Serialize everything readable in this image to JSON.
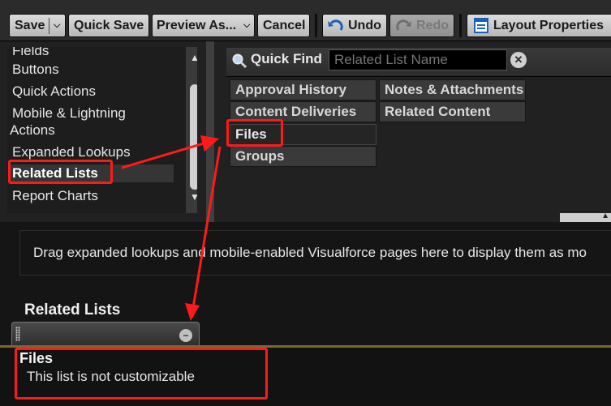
{
  "toolbar": {
    "save_label": "Save",
    "quick_save_label": "Quick Save",
    "preview_as_label": "Preview As...",
    "cancel_label": "Cancel",
    "undo_label": "Undo",
    "redo_label": "Redo",
    "layout_properties_label": "Layout Properties"
  },
  "palette": {
    "categories": [
      {
        "label": "Fields"
      },
      {
        "label": "Buttons"
      },
      {
        "label": "Quick Actions"
      },
      {
        "label": "Mobile & Lightning"
      },
      {
        "label": "Actions"
      },
      {
        "label": "Expanded Lookups"
      },
      {
        "label": "Related Lists",
        "selected": true
      },
      {
        "label": "Report Charts"
      }
    ],
    "quick_find": {
      "label": "Quick Find",
      "placeholder": "Related List Name"
    },
    "items": [
      {
        "label": "Approval History"
      },
      {
        "label": "Notes & Attachments"
      },
      {
        "label": "Content Deliveries"
      },
      {
        "label": "Related Content"
      },
      {
        "label": "Files",
        "in_use": true
      },
      {
        "label": "Groups"
      }
    ]
  },
  "layout": {
    "drop_zone_text": "Drag expanded lookups and mobile-enabled Visualforce pages here to display them as mo",
    "section_title": "Related Lists",
    "related_list": {
      "name": "Files",
      "message": "This list is not customizable"
    }
  },
  "colors": {
    "annotation": "#ff1a1a",
    "accent_strip": "#7c6633"
  }
}
